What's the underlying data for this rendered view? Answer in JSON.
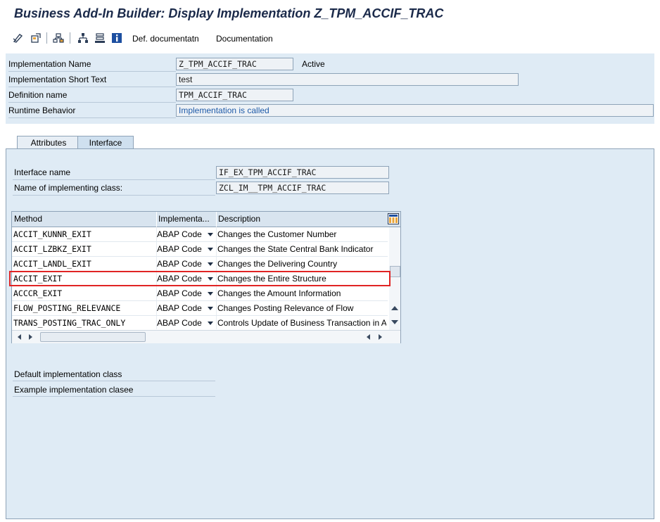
{
  "title": "Business Add-In Builder: Display Implementation Z_TPM_ACCIF_TRAC",
  "toolbar": {
    "icons": [
      "edit-toggle-icon",
      "other-object-icon",
      "hierarchy-icon",
      "tree-icon",
      "stack-icon",
      "info-icon"
    ],
    "def_doc_label": "Def. documentatn",
    "doc_label": "Documentation"
  },
  "header": {
    "impl_name_label": "Implementation Name",
    "impl_name_value": "Z_TPM_ACCIF_TRAC",
    "status": "Active",
    "short_text_label": "Implementation Short Text",
    "short_text_value": "test",
    "def_name_label": "Definition name",
    "def_name_value": "TPM_ACCIF_TRAC",
    "runtime_label": "Runtime Behavior",
    "runtime_value": "Implementation is called"
  },
  "tabs": [
    {
      "label": "Attributes",
      "active": false
    },
    {
      "label": "Interface",
      "active": true
    }
  ],
  "interface": {
    "name_label": "Interface name",
    "name_value": "IF_EX_TPM_ACCIF_TRAC",
    "class_label": "Name of implementing class:",
    "class_value": "ZCL_IM__TPM_ACCIF_TRAC"
  },
  "table": {
    "columns": [
      "Method",
      "Implementa...",
      "Description"
    ],
    "rows": [
      {
        "method": "ACCIT_KUNNR_EXIT",
        "impl": "ABAP Code",
        "desc": "Changes the Customer Number"
      },
      {
        "method": "ACCIT_LZBKZ_EXIT",
        "impl": "ABAP Code",
        "desc": "Changes the State Central Bank Indicator"
      },
      {
        "method": "ACCIT_LANDL_EXIT",
        "impl": "ABAP Code",
        "desc": "Changes the Delivering Country"
      },
      {
        "method": "ACCIT_EXIT",
        "impl": "ABAP Code",
        "desc": "Changes the Entire Structure"
      },
      {
        "method": "ACCCR_EXIT",
        "impl": "ABAP Code",
        "desc": "Changes the Amount Information"
      },
      {
        "method": "FLOW_POSTING_RELEVANCE",
        "impl": "ABAP Code",
        "desc": "Changes Posting Relevance of Flow"
      },
      {
        "method": "TRANS_POSTING_TRAC_ONLY",
        "impl": "ABAP Code",
        "desc": "Controls Update of Business Transaction in A"
      }
    ]
  },
  "footer_fields": {
    "default_class_label": "Default implementation class",
    "example_class_label": "Example implementation clasee"
  },
  "colors": {
    "panel": "#dfebf5",
    "highlight": "#e02424",
    "link_text": "#1d5aa8"
  }
}
